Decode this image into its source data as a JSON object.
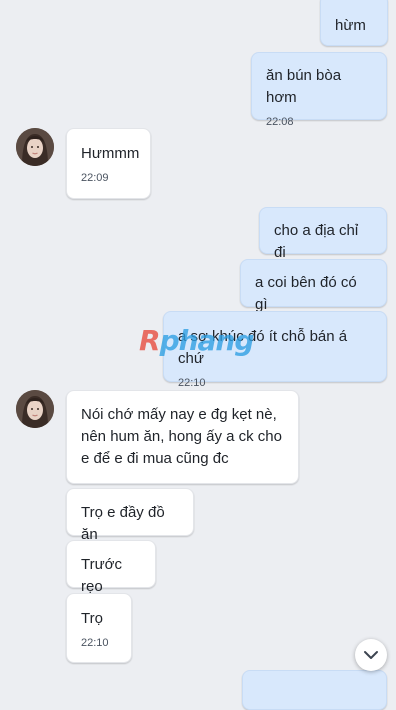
{
  "conversation": {
    "messages": [
      {
        "id": "m1",
        "direction": "out",
        "text": "hừm",
        "time": ""
      },
      {
        "id": "m2",
        "direction": "out",
        "text": "ăn bún bòa hơm",
        "time": "22:08"
      },
      {
        "id": "m3",
        "direction": "in",
        "text": "Hưmmm",
        "time": "22:09"
      },
      {
        "id": "m4",
        "direction": "out",
        "text": "cho a địa chỉ đi",
        "time": ""
      },
      {
        "id": "m5",
        "direction": "out",
        "text": "a coi bên đó có gì",
        "time": ""
      },
      {
        "id": "m6",
        "direction": "out",
        "text": "a sợ khúc đó ít chỗ bán á chứ",
        "time": "22:10"
      },
      {
        "id": "m7",
        "direction": "in",
        "text": "Nói chớ mấy nay e đg kẹt nè,\nnên hum ăn, hong ấy a ck cho\ne để e đi mua cũng đc",
        "time": ""
      },
      {
        "id": "m8",
        "direction": "in",
        "text": "Trọ e đầy đồ ăn",
        "time": ""
      },
      {
        "id": "m9",
        "direction": "in",
        "text": "Trước rẹo",
        "time": ""
      },
      {
        "id": "m10",
        "direction": "in",
        "text": "Trọ",
        "time": "22:10"
      }
    ]
  },
  "watermark": {
    "first_letter": "R",
    "rest": "phang"
  },
  "controls": {
    "scroll_down_icon": "chevron-down-icon"
  },
  "colors": {
    "background": "#eceef2",
    "outgoing_bubble": "#d8e8fc",
    "incoming_bubble": "#ffffff",
    "watermark_red": "#e84a3c",
    "watermark_blue": "#2d9fe3"
  }
}
